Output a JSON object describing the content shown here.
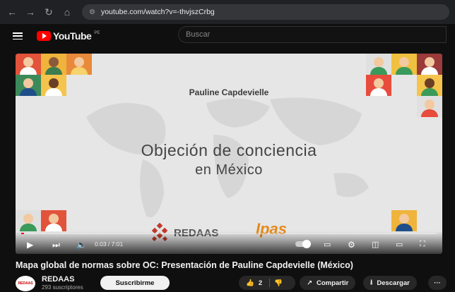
{
  "browser": {
    "url": "youtube.com/watch?v=-thvjszCrbg"
  },
  "header": {
    "logo_text": "YouTube",
    "region": "PE",
    "search_placeholder": "Buscar"
  },
  "video": {
    "presenter": "Pauline Capdevielle",
    "title_line1": "Objeción de conciencia",
    "title_line2": "en México",
    "logo_redaas": "REDAAS",
    "logo_ipas": "Ipas",
    "time": "0:03 / 7:01",
    "progress_fraction": 0.007
  },
  "below": {
    "title": "Mapa global de normas sobre OC: Presentación de Pauline Capdevielle (México)",
    "channel": "REDAAS",
    "avatar_text": "REDAAS",
    "subscribers": "293 suscriptores",
    "subscribe_label": "Suscribirme",
    "likes": "2",
    "share_label": "Compartir",
    "download_label": "Descargar",
    "more_label": "···"
  },
  "colors": {
    "accent": "#ff0000",
    "ipas": "#e48a1c",
    "redaas": "#c0392b"
  }
}
